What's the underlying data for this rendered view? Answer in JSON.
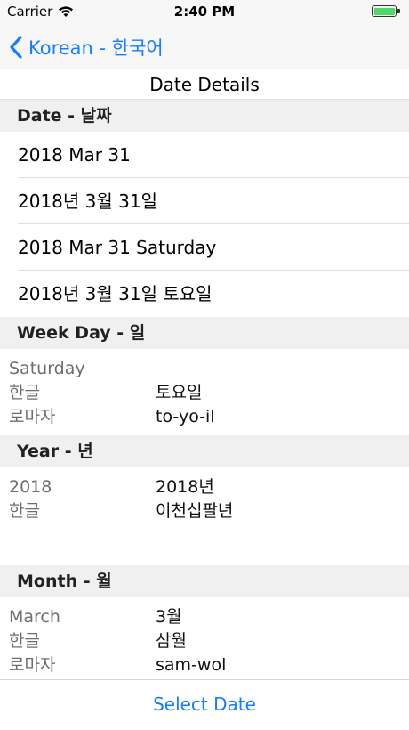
{
  "status_bar": {
    "carrier": "Carrier",
    "time": "2:40 PM",
    "battery_level": 1.0
  },
  "nav": {
    "back_label": "Korean - 한국어"
  },
  "title": "Date Details",
  "sections": {
    "date": {
      "header": "Date - 날짜",
      "rows": [
        "2018 Mar 31",
        "2018년 3월 31일",
        "2018 Mar 31 Saturday",
        "2018년 3월 31일 토요일"
      ]
    },
    "weekday": {
      "header": "Week Day - 일",
      "lines": [
        {
          "label": "Saturday",
          "value": ""
        },
        {
          "label": "한글",
          "value": "토요일"
        },
        {
          "label": "로마자",
          "value": "to-yo-il"
        }
      ]
    },
    "year": {
      "header": "Year - 년",
      "lines": [
        {
          "label": "2018",
          "value": "2018년"
        },
        {
          "label": "한글",
          "value": "이천십팔년"
        }
      ]
    },
    "month": {
      "header": "Month - 월",
      "lines": [
        {
          "label": "March",
          "value": "3월"
        },
        {
          "label": "한글",
          "value": "삼월"
        },
        {
          "label": "로마자",
          "value": "sam-wol"
        }
      ]
    }
  },
  "bottom": {
    "select_date_label": "Select Date"
  },
  "colors": {
    "accent": "#157efb",
    "section_bg": "#f0f0f0",
    "battery": "#4cd964"
  },
  "icons": [
    "wifi-icon",
    "battery-icon",
    "chevron-left-icon"
  ]
}
